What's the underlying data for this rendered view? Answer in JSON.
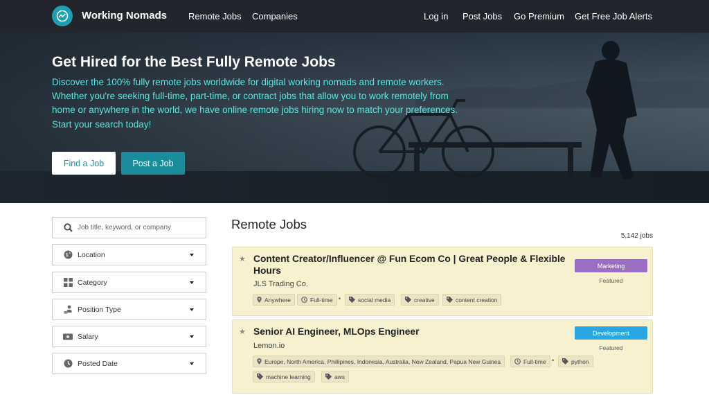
{
  "brand": {
    "name": "Working Nomads"
  },
  "nav": {
    "remote_jobs": "Remote Jobs",
    "companies": "Companies",
    "log_in": "Log in",
    "post_jobs": "Post Jobs",
    "go_premium": "Go Premium",
    "free_alerts": "Get Free Job Alerts"
  },
  "hero": {
    "title": "Get Hired for the Best Fully Remote Jobs",
    "description": "Discover the 100% fully remote jobs worldwide for digital working nomads and remote workers. Whether you're seeking full-time, part-time, or contract jobs that allow you to work remotely from home or anywhere in the world, we have online remote jobs hiring now to match your preferences. Start your search today!",
    "find_button": "Find a Job",
    "post_button": "Post a Job"
  },
  "filters": {
    "search_placeholder": "Job title, keyword, or company",
    "location": "Location",
    "category": "Category",
    "position_type": "Position Type",
    "salary": "Salary",
    "posted_date": "Posted Date"
  },
  "main": {
    "title": "Remote Jobs",
    "count": "5,142 jobs"
  },
  "jobs": [
    {
      "title": "Content Creator/Influencer @ Fun Ecom Co | Great People & Flexible Hours",
      "company": "JLS Trading Co.",
      "category": "Marketing",
      "category_color": "#9b6fc0",
      "featured": "Featured",
      "location": "Anywhere",
      "type": "Full-time",
      "tags": [
        "social media",
        "creative",
        "content creation"
      ]
    },
    {
      "title": "Senior AI Engineer, MLOps Engineer",
      "company": "Lemon.io",
      "category": "Development",
      "category_color": "#2aa7e0",
      "featured": "Featured",
      "location": "Europe, North America, Phillipines, Indonesia, Australia, New Zealand, Papua New Guinea",
      "type": "Full-time",
      "tags": [
        "python",
        "machine learning",
        "aws"
      ]
    }
  ],
  "colors": {
    "accent": "#1ea0b3",
    "hero_text": "#5ce6e0",
    "card_bg": "#f7f1cf"
  }
}
